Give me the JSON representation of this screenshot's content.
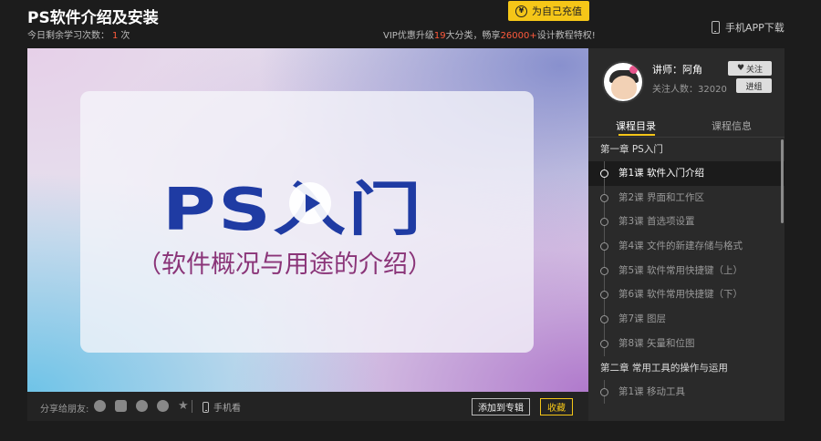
{
  "header": {
    "title": "PS软件介绍及安装",
    "remaining_label": "今日剩余学习次数：",
    "remaining_count": "1",
    "remaining_unit": "次",
    "recharge_icon": "¥",
    "recharge_label": "为自己充值",
    "vip_prefix": "VIP优惠升级",
    "vip_categories": "19",
    "vip_mid": "大分类，畅享",
    "vip_courses": "26000+",
    "vip_suffix": "设计教程特权!",
    "app_download": "手机APP下载"
  },
  "video": {
    "title_text": "PS入门",
    "subtitle_text": "（软件概况与用途的介绍）"
  },
  "bottom_bar": {
    "share_label": "分享给朋友:",
    "share_icons": [
      "qq-icon",
      "qzone-icon",
      "weibo-icon",
      "wechat-icon",
      "favorite-star-icon"
    ],
    "mobile_watch": "手机看",
    "add_to_album": "添加到专辑",
    "collect": "收藏"
  },
  "teacher": {
    "name": "讲师：阿角",
    "followers": "关注人数：32020",
    "follow_button": "关注",
    "enter_button": "进组"
  },
  "tabs": [
    {
      "label": "课程目录",
      "active": true
    },
    {
      "label": "课程信息",
      "active": false
    }
  ],
  "catalog": [
    {
      "type": "chapter",
      "label": "第一章 PS入门"
    },
    {
      "type": "lesson",
      "label": "第1课 软件入门介绍",
      "active": true
    },
    {
      "type": "lesson",
      "label": "第2课 界面和工作区"
    },
    {
      "type": "lesson",
      "label": "第3课 首选项设置"
    },
    {
      "type": "lesson",
      "label": "第4课 文件的新建存储与格式"
    },
    {
      "type": "lesson",
      "label": "第5课 软件常用快捷键（上）"
    },
    {
      "type": "lesson",
      "label": "第6课 软件常用快捷键（下）"
    },
    {
      "type": "lesson",
      "label": "第7课 图层"
    },
    {
      "type": "lesson",
      "label": "第8课 矢量和位图"
    },
    {
      "type": "chapter",
      "label": "第二章 常用工具的操作与运用"
    },
    {
      "type": "lesson",
      "label": "第1课 移动工具"
    }
  ],
  "colors": {
    "accent": "#f5c618",
    "highlight": "#ff5a3c",
    "panel_bg": "#2a2a2a",
    "page_bg": "#1c1c1c"
  }
}
